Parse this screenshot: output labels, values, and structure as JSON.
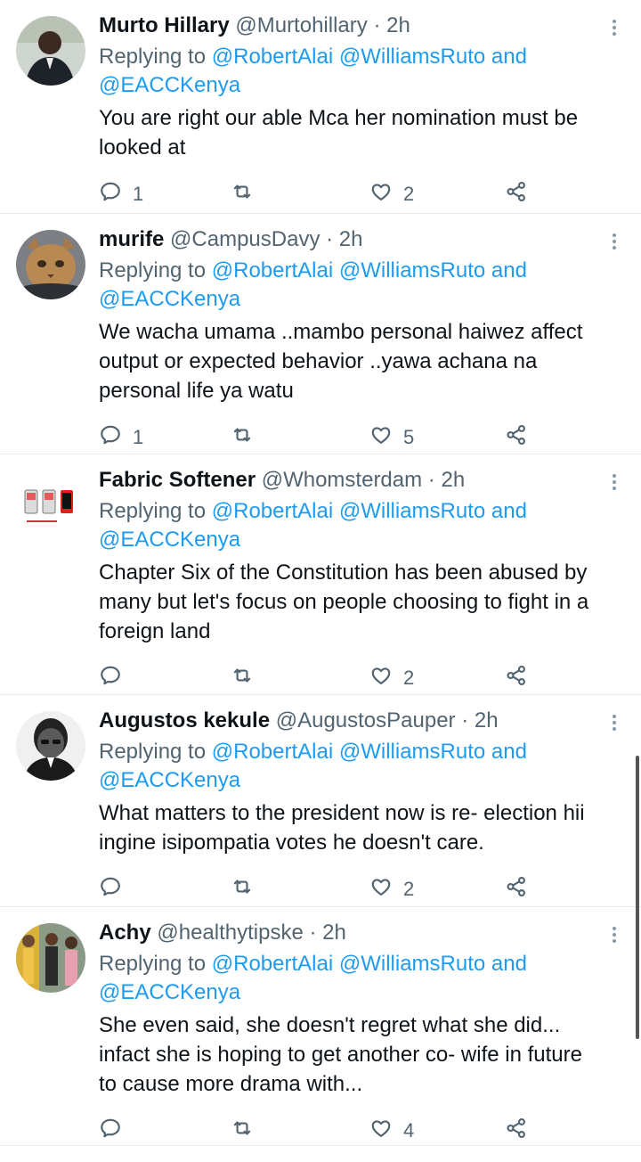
{
  "colors": {
    "accent": "#1d9bf0",
    "muted": "#536471",
    "text": "#0f1419",
    "divider": "#e6ecf0"
  },
  "icons": {
    "reply": "reply-icon",
    "retweet": "retweet-icon",
    "like": "heart-icon",
    "share": "share-icon",
    "more": "more-vertical-icon"
  },
  "tweets": [
    {
      "name": "Murto Hillary",
      "handle": "@Murtohillary",
      "time": "2h",
      "replying_prefix": "Replying to",
      "mention1": "@RobertAlai",
      "mention2": "@WilliamsRuto",
      "and_word": "and",
      "mention3": "@EACCKenya",
      "lines": [
        "You are right our able Mca her nomination must be",
        "looked at"
      ],
      "replies": "1",
      "retweets": "",
      "likes": "2"
    },
    {
      "name": "murife",
      "handle": "@CampusDavy",
      "time": "2h",
      "replying_prefix": "Replying to",
      "mention1": "@RobertAlai",
      "mention2": "@WilliamsRuto",
      "and_word": "and",
      "mention3": "@EACCKenya",
      "lines": [
        "We wacha umama ..mambo personal haiwez affect",
        "output or expected behavior ..yawa achana na",
        "personal life ya watu"
      ],
      "replies": "1",
      "retweets": "",
      "likes": "5"
    },
    {
      "name": "Fabric Softener",
      "handle": "@Whomsterdam",
      "time": "2h",
      "replying_prefix": "Replying to",
      "mention1": "@RobertAlai",
      "mention2": "@WilliamsRuto",
      "and_word": "and",
      "mention3": "@EACCKenya",
      "lines": [
        "Chapter Six of the Constitution has been abused by",
        "many but let's focus on people choosing to fight in a",
        "foreign land"
      ],
      "replies": "",
      "retweets": "",
      "likes": "2"
    },
    {
      "name": "Augustos kekule",
      "handle": "@AugustosPauper",
      "time": "2h",
      "replying_prefix": "Replying to",
      "mention1": "@RobertAlai",
      "mention2": "@WilliamsRuto",
      "and_word": "and",
      "mention3": "@EACCKenya",
      "lines": [
        "What matters to the president now is re- election hii",
        "ingine isipompatia votes he doesn't care."
      ],
      "replies": "",
      "retweets": "",
      "likes": "2"
    },
    {
      "name": "Achy",
      "handle": "@healthytipske",
      "time": "2h",
      "replying_prefix": "Replying to",
      "mention1": "@RobertAlai",
      "mention2": "@WilliamsRuto",
      "and_word": "and",
      "mention3": "@EACCKenya",
      "lines": [
        "She even said, she doesn't regret what she did...",
        "infact she is hoping to get another co- wife in future",
        "to cause more drama with..."
      ],
      "replies": "",
      "retweets": "",
      "likes": "4"
    }
  ]
}
